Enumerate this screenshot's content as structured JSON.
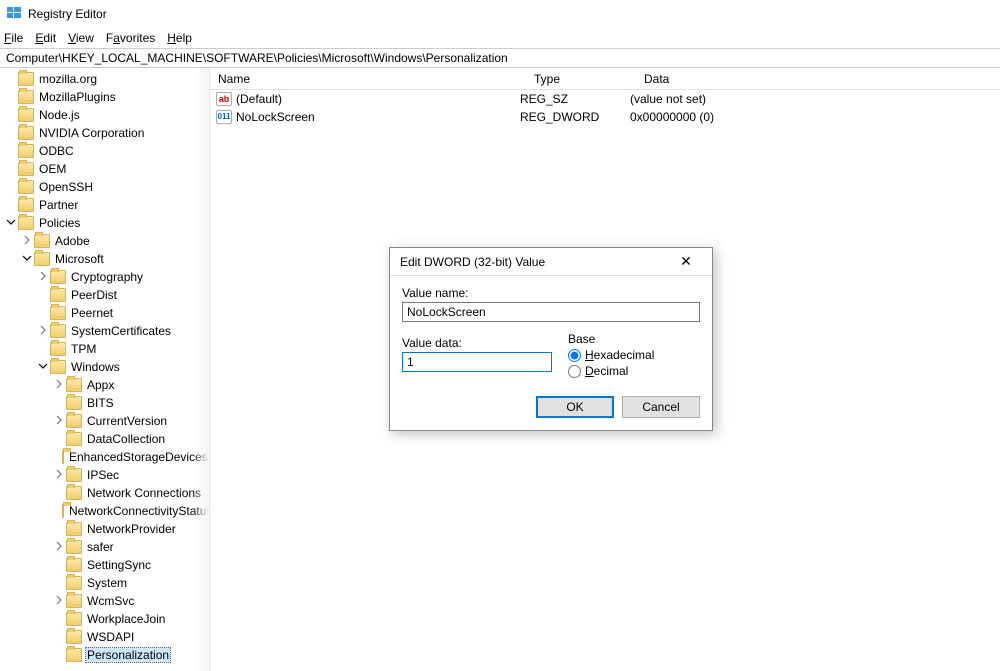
{
  "window": {
    "title": "Registry Editor"
  },
  "menu": {
    "file": "File",
    "edit": "Edit",
    "view": "View",
    "favorites": "Favorites",
    "help": "Help"
  },
  "address": "Computer\\HKEY_LOCAL_MACHINE\\SOFTWARE\\Policies\\Microsoft\\Windows\\Personalization",
  "tree": [
    {
      "level": 0,
      "arrow": "",
      "label": "mozilla.org"
    },
    {
      "level": 0,
      "arrow": "",
      "label": "MozillaPlugins"
    },
    {
      "level": 0,
      "arrow": "",
      "label": "Node.js"
    },
    {
      "level": 0,
      "arrow": "",
      "label": "NVIDIA Corporation"
    },
    {
      "level": 0,
      "arrow": "",
      "label": "ODBC"
    },
    {
      "level": 0,
      "arrow": "",
      "label": "OEM"
    },
    {
      "level": 0,
      "arrow": "",
      "label": "OpenSSH"
    },
    {
      "level": 0,
      "arrow": "",
      "label": "Partner"
    },
    {
      "level": 0,
      "arrow": "open",
      "label": "Policies"
    },
    {
      "level": 1,
      "arrow": "closed",
      "label": "Adobe"
    },
    {
      "level": 1,
      "arrow": "open",
      "label": "Microsoft"
    },
    {
      "level": 2,
      "arrow": "closed",
      "label": "Cryptography"
    },
    {
      "level": 2,
      "arrow": "",
      "label": "PeerDist"
    },
    {
      "level": 2,
      "arrow": "",
      "label": "Peernet"
    },
    {
      "level": 2,
      "arrow": "closed",
      "label": "SystemCertificates"
    },
    {
      "level": 2,
      "arrow": "",
      "label": "TPM"
    },
    {
      "level": 2,
      "arrow": "open",
      "label": "Windows"
    },
    {
      "level": 3,
      "arrow": "closed",
      "label": "Appx"
    },
    {
      "level": 3,
      "arrow": "",
      "label": "BITS"
    },
    {
      "level": 3,
      "arrow": "closed",
      "label": "CurrentVersion"
    },
    {
      "level": 3,
      "arrow": "",
      "label": "DataCollection"
    },
    {
      "level": 3,
      "arrow": "",
      "label": "EnhancedStorageDevices"
    },
    {
      "level": 3,
      "arrow": "closed",
      "label": "IPSec"
    },
    {
      "level": 3,
      "arrow": "",
      "label": "Network Connections"
    },
    {
      "level": 3,
      "arrow": "",
      "label": "NetworkConnectivityStatus"
    },
    {
      "level": 3,
      "arrow": "",
      "label": "NetworkProvider"
    },
    {
      "level": 3,
      "arrow": "closed",
      "label": "safer"
    },
    {
      "level": 3,
      "arrow": "",
      "label": "SettingSync"
    },
    {
      "level": 3,
      "arrow": "",
      "label": "System"
    },
    {
      "level": 3,
      "arrow": "closed",
      "label": "WcmSvc"
    },
    {
      "level": 3,
      "arrow": "",
      "label": "WorkplaceJoin"
    },
    {
      "level": 3,
      "arrow": "",
      "label": "WSDAPI"
    },
    {
      "level": 3,
      "arrow": "",
      "label": "Personalization",
      "selected": true
    }
  ],
  "cols": {
    "name": "Name",
    "type": "Type",
    "data": "Data"
  },
  "rows": [
    {
      "icon": "sz",
      "name": "(Default)",
      "type": "REG_SZ",
      "data": "(value not set)"
    },
    {
      "icon": "dw",
      "name": "NoLockScreen",
      "type": "REG_DWORD",
      "data": "0x00000000 (0)"
    }
  ],
  "dialog": {
    "title": "Edit DWORD (32-bit) Value",
    "valueNameLabel": "Value name:",
    "valueName": "NoLockScreen",
    "valueDataLabel": "Value data:",
    "valueData": "1",
    "baseLabel": "Base",
    "hex": "Hexadecimal",
    "dec": "Decimal",
    "ok": "OK",
    "cancel": "Cancel"
  }
}
